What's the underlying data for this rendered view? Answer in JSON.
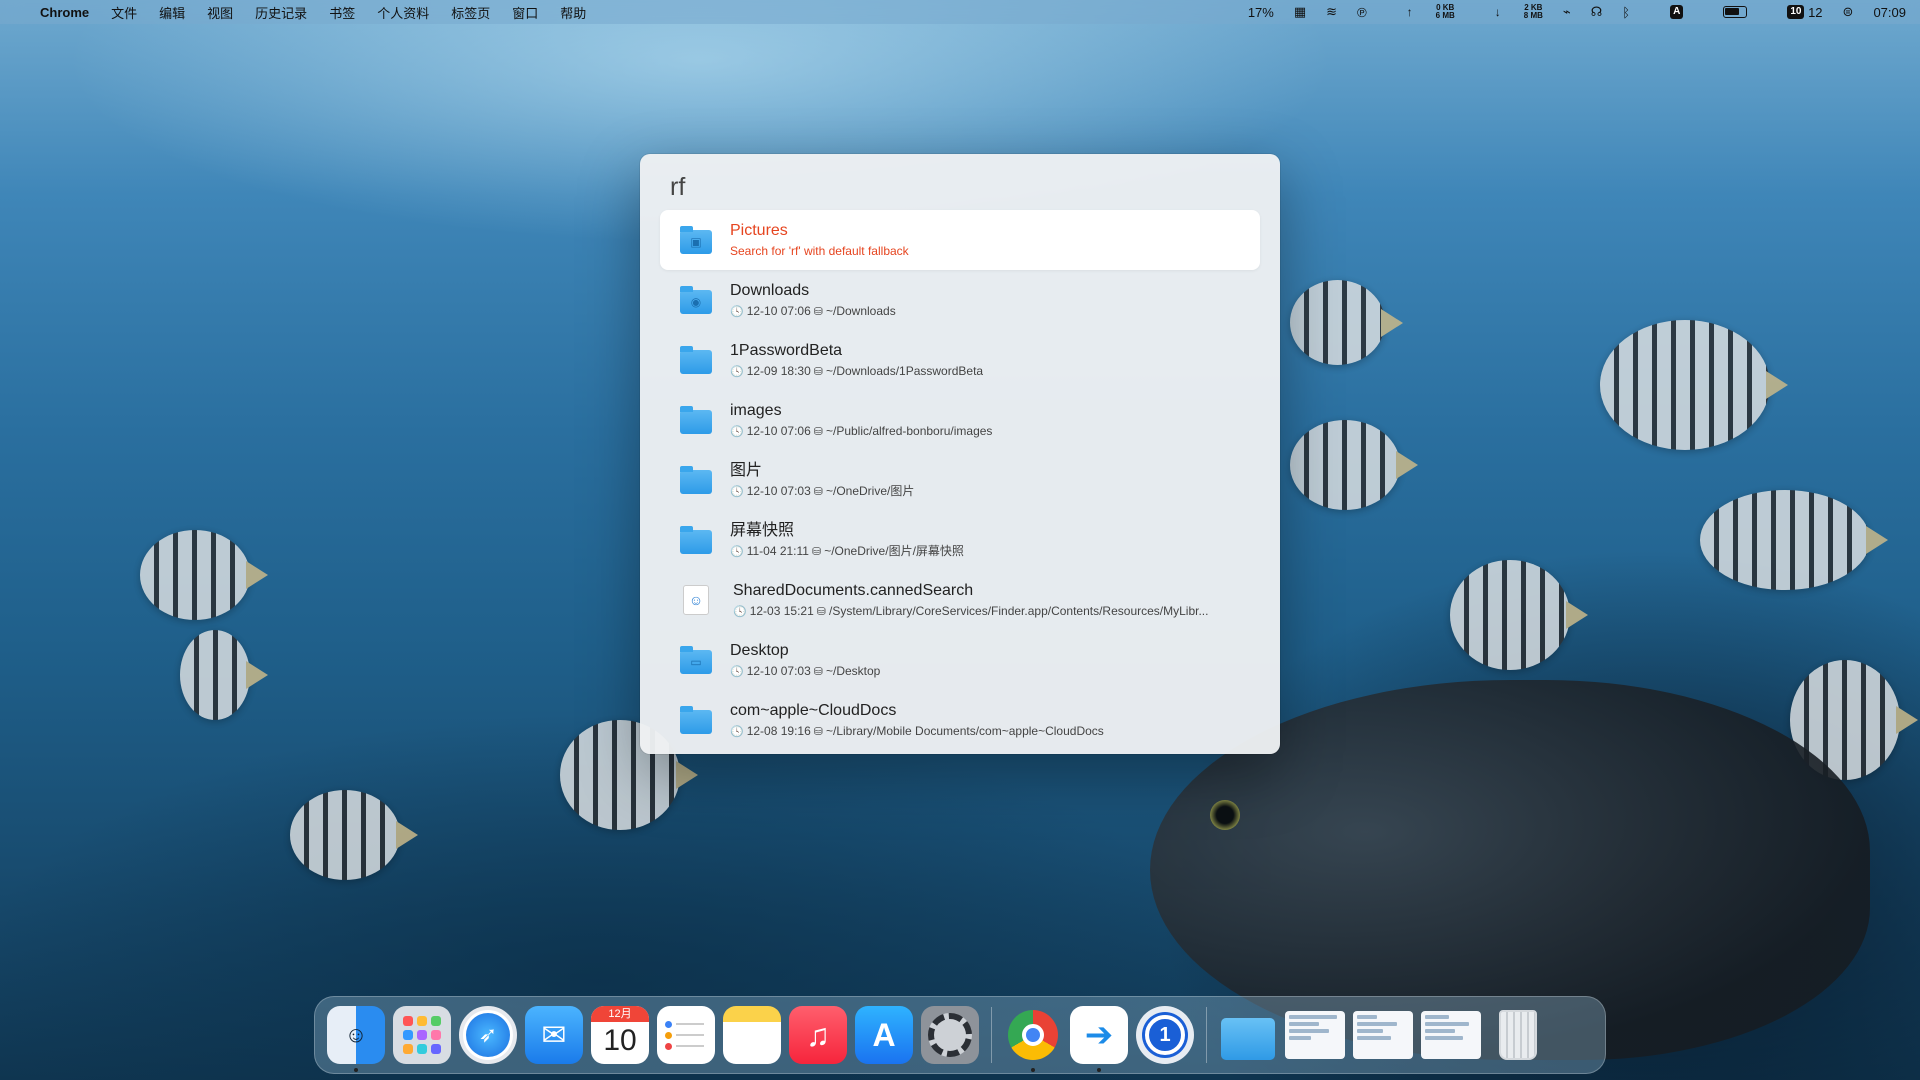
{
  "menubar": {
    "app_name": "Chrome",
    "menus": [
      "文件",
      "编辑",
      "视图",
      "历史记录",
      "书签",
      "个人资料",
      "标签页",
      "窗口",
      "帮助"
    ],
    "status": {
      "cpu": "17%",
      "upload": "0 KB",
      "upload_total": "6 MB",
      "download": "2 KB",
      "download_total": "8 MB",
      "input_source": "A",
      "day_badge": "10",
      "day_count": "12",
      "time": "07:09"
    }
  },
  "alfred": {
    "query": "rf",
    "results": [
      {
        "title": "Pictures",
        "subtitle": "Search for 'rf' with default fallback",
        "time": "",
        "path": "",
        "icon": "pictures-folder-icon",
        "glyph": "▣",
        "selected": true
      },
      {
        "title": "Downloads",
        "time": "12-10 07:06",
        "path": "~/Downloads",
        "icon": "downloads-folder-icon",
        "glyph": "◉"
      },
      {
        "title": "1PasswordBeta",
        "time": "12-09 18:30",
        "path": "~/Downloads/1PasswordBeta",
        "icon": "folder-icon",
        "glyph": ""
      },
      {
        "title": "images",
        "time": "12-10 07:06",
        "path": "~/Public/alfred-bonboru/images",
        "icon": "folder-icon",
        "glyph": ""
      },
      {
        "title": "图片",
        "time": "12-10 07:03",
        "path": "~/OneDrive/图片",
        "icon": "folder-icon",
        "glyph": ""
      },
      {
        "title": "屏幕快照",
        "time": "11-04 21:11",
        "path": "~/OneDrive/图片/屏幕快照",
        "icon": "folder-icon",
        "glyph": ""
      },
      {
        "title": "SharedDocuments.cannedSearch",
        "time": "12-03 15:21",
        "path": "/System/Library/CoreServices/Finder.app/Contents/Resources/MyLibr...",
        "icon": "canned-search-icon",
        "glyph": ""
      },
      {
        "title": "Desktop",
        "time": "12-10 07:03",
        "path": "~/Desktop",
        "icon": "desktop-folder-icon",
        "glyph": "▭"
      },
      {
        "title": "com~apple~CloudDocs",
        "time": "12-08 19:16",
        "path": "~/Library/Mobile Documents/com~apple~CloudDocs",
        "icon": "folder-icon",
        "glyph": ""
      }
    ]
  },
  "dock": {
    "calendar_month": "12月",
    "calendar_day": "10",
    "apps": [
      "Finder",
      "Launchpad",
      "Safari",
      "Mail",
      "Calendar",
      "Reminders",
      "Notes",
      "Music",
      "App Store",
      "System Preferences",
      "Google Chrome",
      "Transmit",
      "1Password",
      "Folder",
      "Window",
      "Window",
      "Window",
      "Trash"
    ]
  }
}
